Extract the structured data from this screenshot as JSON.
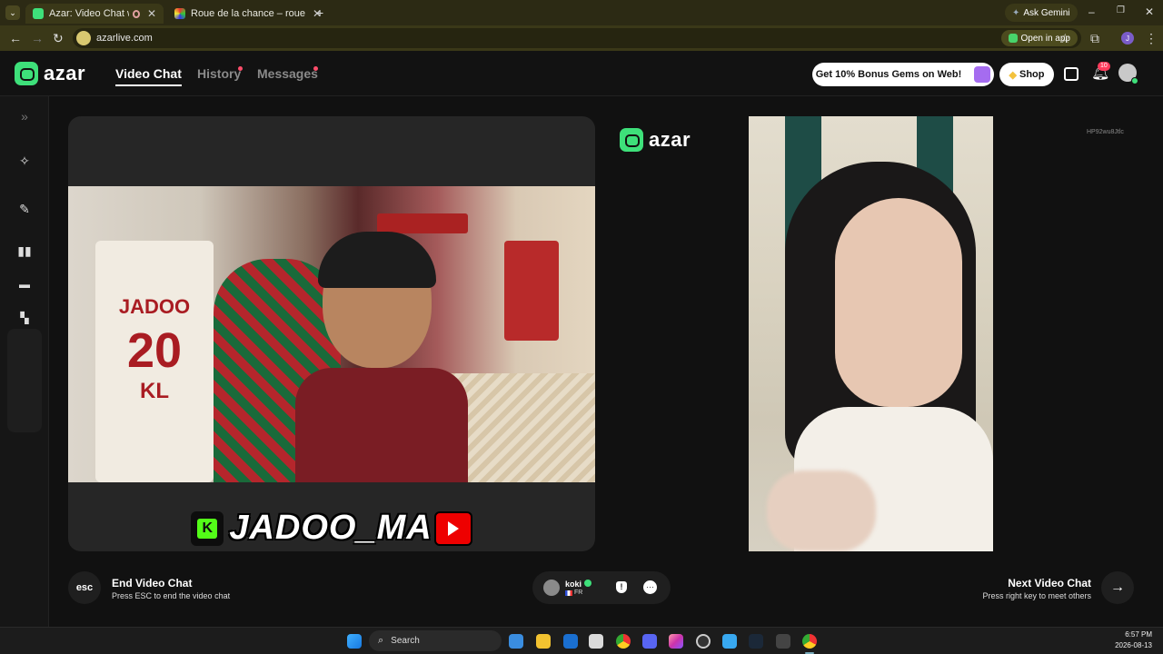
{
  "browser": {
    "tabs": [
      {
        "title": "Azar: Video Chat with New",
        "active": true
      },
      {
        "title": "Roue de la chance – roue aléat",
        "active": false
      }
    ],
    "url": "azarlive.com",
    "open_in_app": "Open in app",
    "ask_gemini": "Ask Gemini"
  },
  "header": {
    "logo": "azar",
    "nav": [
      "Video Chat",
      "History",
      "Messages"
    ],
    "bonus": "Get 10% Bonus Gems on Web!",
    "shop": "Shop",
    "notification_count": "10"
  },
  "center_logo": "azar",
  "self": {
    "jersey_name": "JADOO",
    "jersey_number": "20",
    "jersey_initials": "KL",
    "handle": "JADOO_MA",
    "kick_letter": "K"
  },
  "remote": {
    "id": "HP92wu8Jtlc"
  },
  "controls": {
    "esc": "esc",
    "end_title": "End Video Chat",
    "end_sub": "Press ESC to end the video chat",
    "next_title": "Next Video Chat",
    "next_sub": "Press right key to meet others",
    "partner_name": "koki",
    "partner_country": "FR"
  },
  "taskbar": {
    "search": "Search",
    "time": "6:57 PM",
    "date": "2026-08-13"
  },
  "colors": {
    "brand_green": "#3ee07a",
    "tab_bg": "#2c2a14",
    "panel_bg": "#262626"
  }
}
